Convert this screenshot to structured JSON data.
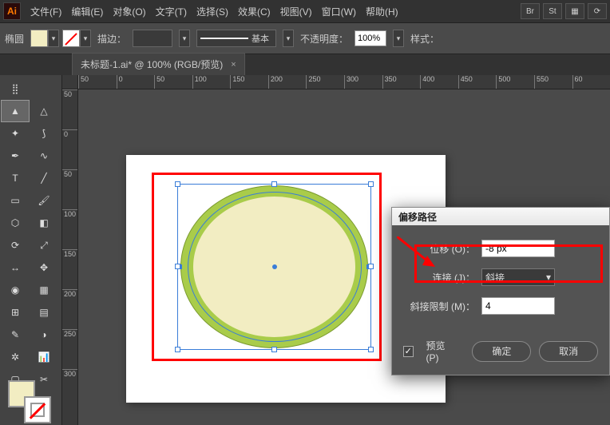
{
  "app": {
    "brand": "Ai"
  },
  "menu": [
    "文件(F)",
    "编辑(E)",
    "对象(O)",
    "文字(T)",
    "选择(S)",
    "效果(C)",
    "视图(V)",
    "窗口(W)",
    "帮助(H)"
  ],
  "titlebar_buttons": [
    "Br",
    "St"
  ],
  "ctrlbar": {
    "shape_name": "椭圆",
    "stroke_label": "描边：",
    "base_label": "基本",
    "opacity_label": "不透明度：",
    "opacity_value": "100%",
    "style_label": "样式："
  },
  "tab": {
    "title": "未标题-1.ai* @ 100% (RGB/预览)"
  },
  "ruler_h": [
    "50",
    "0",
    "50",
    "100",
    "150",
    "200",
    "250",
    "300",
    "350",
    "400",
    "450",
    "500",
    "550",
    "60"
  ],
  "ruler_v": [
    "50",
    "0",
    "50",
    "100",
    "150",
    "200",
    "250",
    "300"
  ],
  "dialog": {
    "title": "偏移路径",
    "offset_label": "位移 (O)：",
    "offset_value": "-8 px",
    "join_label": "连接 (J)：",
    "join_value": "斜接",
    "miter_label": "斜接限制 (M)：",
    "miter_value": "4",
    "preview_label": "预览 (P)",
    "ok": "确定",
    "cancel": "取消"
  }
}
